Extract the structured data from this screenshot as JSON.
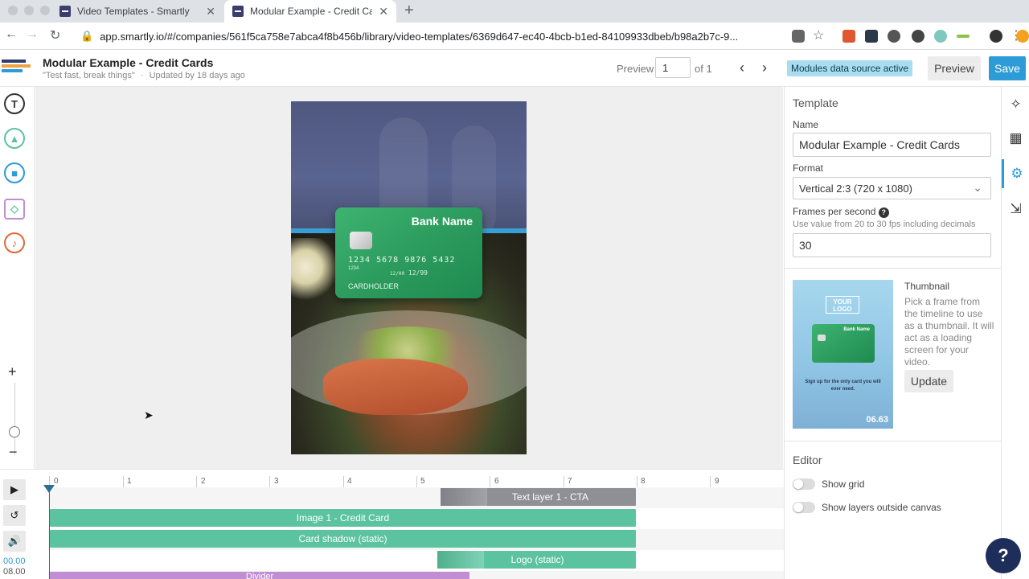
{
  "browser": {
    "tabs": [
      {
        "label": "Video Templates - Smartly"
      },
      {
        "label": "Modular Example - Credit Cards"
      }
    ],
    "url": "app.smartly.io/#/companies/561f5ca758e7abca4f8b456b/library/video-templates/6369d647-ec40-4bcb-b1ed-84109933dbeb/b98a2b7c-9..."
  },
  "header": {
    "title": "Modular Example - Credit Cards",
    "subtitle_quote": "\"Test fast, break things\"",
    "subtitle_sep": "·",
    "updated": "Updated by 18 days ago",
    "preview_label": "Preview",
    "page_value": "1",
    "page_of": "of 1",
    "data_source_badge": "Modules data source active",
    "preview_button": "Preview",
    "save_button": "Save"
  },
  "left_tools": {
    "text_tool": "T"
  },
  "canvas": {
    "card": {
      "bank_name": "Bank Name",
      "number": "1234 5678 9876 5432",
      "small": "1234",
      "valid_label": "12/00",
      "expiry": "12/99",
      "holder": "CARDHOLDER"
    }
  },
  "panel": {
    "section_template": "Template",
    "name_label": "Name",
    "name_value": "Modular Example - Credit Cards",
    "format_label": "Format",
    "format_value": "Vertical 2:3 (720 x 1080)",
    "fps_label": "Frames per second",
    "fps_hint": "Use value from 20 to 30 fps including decimals",
    "fps_value": "30",
    "thumbnail_title": "Thumbnail",
    "thumbnail_desc": "Pick a frame from the timeline to use as a thumbnail. It will act as a loading screen for your video.",
    "thumbnail_logo": "YOUR LOGO",
    "thumbnail_bank": "Bank Name",
    "thumbnail_cta": "Sign up for the only card you will ever need.",
    "thumbnail_time": "06.63",
    "update_button": "Update",
    "section_editor": "Editor",
    "show_grid": "Show grid",
    "show_layers": "Show layers outside canvas"
  },
  "timeline": {
    "current_time": "00.00",
    "total_time": "08.00",
    "ruler": [
      "0",
      "1",
      "2",
      "3",
      "4",
      "5",
      "6",
      "7",
      "8",
      "9"
    ],
    "layers": [
      {
        "label": "Text layer 1 - CTA"
      },
      {
        "label": "Image 1 - Credit Card"
      },
      {
        "label": "Card shadow (static)"
      },
      {
        "label": "Logo (static)"
      },
      {
        "label": "Divider"
      }
    ]
  },
  "colors": {
    "accent": "#2d9bd6",
    "track_green": "#5cc3a0",
    "track_gray": "#8e9096",
    "track_purple": "#c18ed4",
    "badge": "#a9dcef"
  }
}
